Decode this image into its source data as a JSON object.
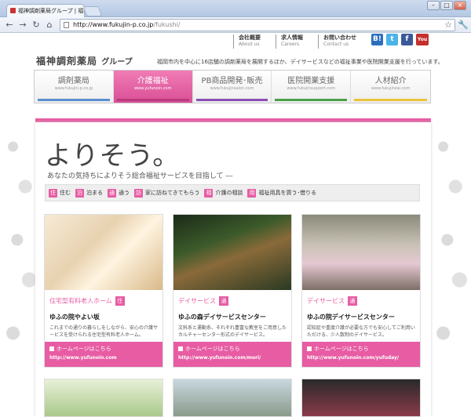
{
  "browser": {
    "tab_title": "福神調剤薬局グループ | 福神",
    "url_host": "http://www.fukujin-p.co.jp",
    "url_path": "/fukushi/"
  },
  "toplinks": [
    {
      "jp": "会社概要",
      "en": "About us"
    },
    {
      "jp": "求人情報",
      "en": "Careers"
    },
    {
      "jp": "お問い合わせ",
      "en": "Contact us"
    }
  ],
  "social": [
    {
      "name": "hatena",
      "label": "B!",
      "color": "#2c6ebd"
    },
    {
      "name": "twitter",
      "label": "t",
      "color": "#4ab3e8"
    },
    {
      "name": "facebook",
      "label": "f",
      "color": "#3b5998"
    },
    {
      "name": "youtube",
      "label": "You",
      "color": "#c4302b"
    }
  ],
  "logo": {
    "main": "福神調剤薬局",
    "sub": "グループ"
  },
  "tagline": "福岡市内を中心に16店舗の調剤薬局を展開するほか、デイサービスなどの福祉事業や医院開業支援を行っています。",
  "gnav": [
    {
      "label": "調剤薬局",
      "url": "www.fukujin-p.co.jp",
      "bar": "#5a8fd0"
    },
    {
      "label": "介護福祉",
      "url": "www.yufunoin.com",
      "bar": "#e75ca3"
    },
    {
      "label": "PB商品開発･販売",
      "url": "www.fukujinsalon.com",
      "bar": "#8a4fb5"
    },
    {
      "label": "医院開業支援",
      "url": "www.fukujinsupport.com",
      "bar": "#4a9e4a"
    },
    {
      "label": "人材紹介",
      "url": "www.fukujinzai.com",
      "bar": "#e8c43a"
    }
  ],
  "hero": {
    "title": "よりそう。",
    "subtitle": "あなたの気持ちによりそう総合福祉サービスを目指して ―"
  },
  "categories": [
    {
      "icon": "住",
      "label": "住む"
    },
    {
      "icon": "泊",
      "label": "泊まる"
    },
    {
      "icon": "通",
      "label": "通う"
    },
    {
      "icon": "訪",
      "label": "家に訪ねてきてもらう"
    },
    {
      "icon": "相",
      "label": "介護の相談"
    },
    {
      "icon": "用",
      "label": "福祉用具を買う･借りる"
    }
  ],
  "cards": [
    {
      "category": "住宅型有料老人ホーム",
      "icon": "住",
      "title": "ゆふの院やよい坂",
      "desc": "これまでの通りの暮らしをしながら、安心の介護サービスを受けられる住宅型有料老人ホーム。",
      "hp_label": "ホームページはこちら",
      "url": "http://www.yufunoin.com"
    },
    {
      "category": "デイサービス",
      "icon": "通",
      "title": "ゆふの森デイサービスセンター",
      "desc": "文科系と運動系、それぞれ豊富な教室をご用意したカルチャーセンター形式のデイサービス。",
      "hp_label": "ホームページはこちら",
      "url": "http://www.yufunoin.com/mori/"
    },
    {
      "category": "デイサービス",
      "icon": "通",
      "title": "ゆふの院デイサービスセンター",
      "desc": "認知症や重度介護が必要な方でも安心してご利用いただける、少人数制のデイサービス。",
      "hp_label": "ホームページはこちら",
      "url": "http://www.yufunoin.com/yufuday/"
    }
  ]
}
